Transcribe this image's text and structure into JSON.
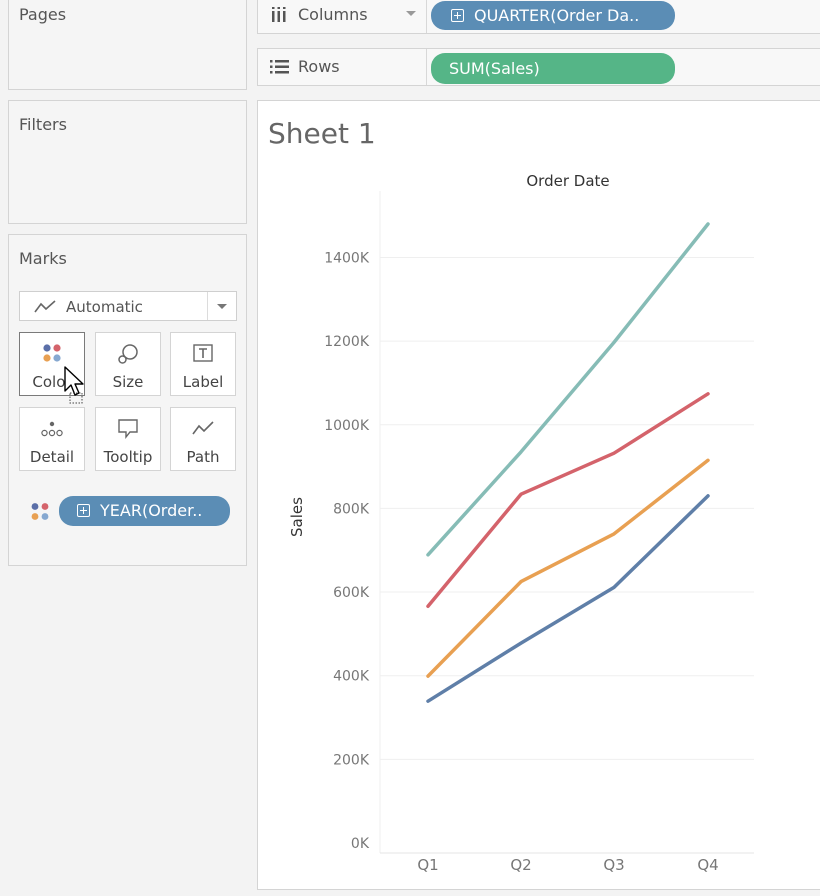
{
  "shelves": {
    "pages_label": "Pages",
    "filters_label": "Filters",
    "columns_label": "Columns",
    "rows_label": "Rows",
    "columns_pill": "QUARTER(Order Da..",
    "rows_pill": "SUM(Sales)"
  },
  "marks": {
    "title": "Marks",
    "mark_type": "Automatic",
    "buttons": [
      {
        "label": "Color",
        "icon": "color-dots-icon"
      },
      {
        "label": "Size",
        "icon": "size-icon"
      },
      {
        "label": "Label",
        "icon": "label-icon"
      },
      {
        "label": "Detail",
        "icon": "detail-icon"
      },
      {
        "label": "Tooltip",
        "icon": "tooltip-icon"
      },
      {
        "label": "Path",
        "icon": "path-icon"
      }
    ],
    "color_pill": "YEAR(Order.."
  },
  "sheet": {
    "title": "Sheet 1"
  },
  "colors": {
    "pill_blue": "#5b8db5",
    "pill_green": "#55b587"
  },
  "chart_data": {
    "type": "line",
    "title": "Order Date",
    "xlabel": "",
    "ylabel": "Sales",
    "categories": [
      "Q1",
      "Q2",
      "Q3",
      "Q4"
    ],
    "ylim": [
      0,
      1550000
    ],
    "yticks": [
      0,
      200000,
      400000,
      600000,
      800000,
      1000000,
      1200000,
      1400000
    ],
    "ytick_labels": [
      "0K",
      "200K",
      "400K",
      "600K",
      "800K",
      "1000K",
      "1200K",
      "1400K"
    ],
    "grid": true,
    "series": [
      {
        "values": [
          689000,
          935000,
          1197000,
          1480000
        ],
        "color": "#86bcb6"
      },
      {
        "values": [
          566000,
          834000,
          932000,
          1074000
        ],
        "color": "#d4636b"
      },
      {
        "values": [
          399000,
          625000,
          739000,
          915000
        ],
        "color": "#e8a052"
      },
      {
        "values": [
          339000,
          478000,
          611000,
          830000
        ],
        "color": "#5f7fa8"
      }
    ]
  }
}
